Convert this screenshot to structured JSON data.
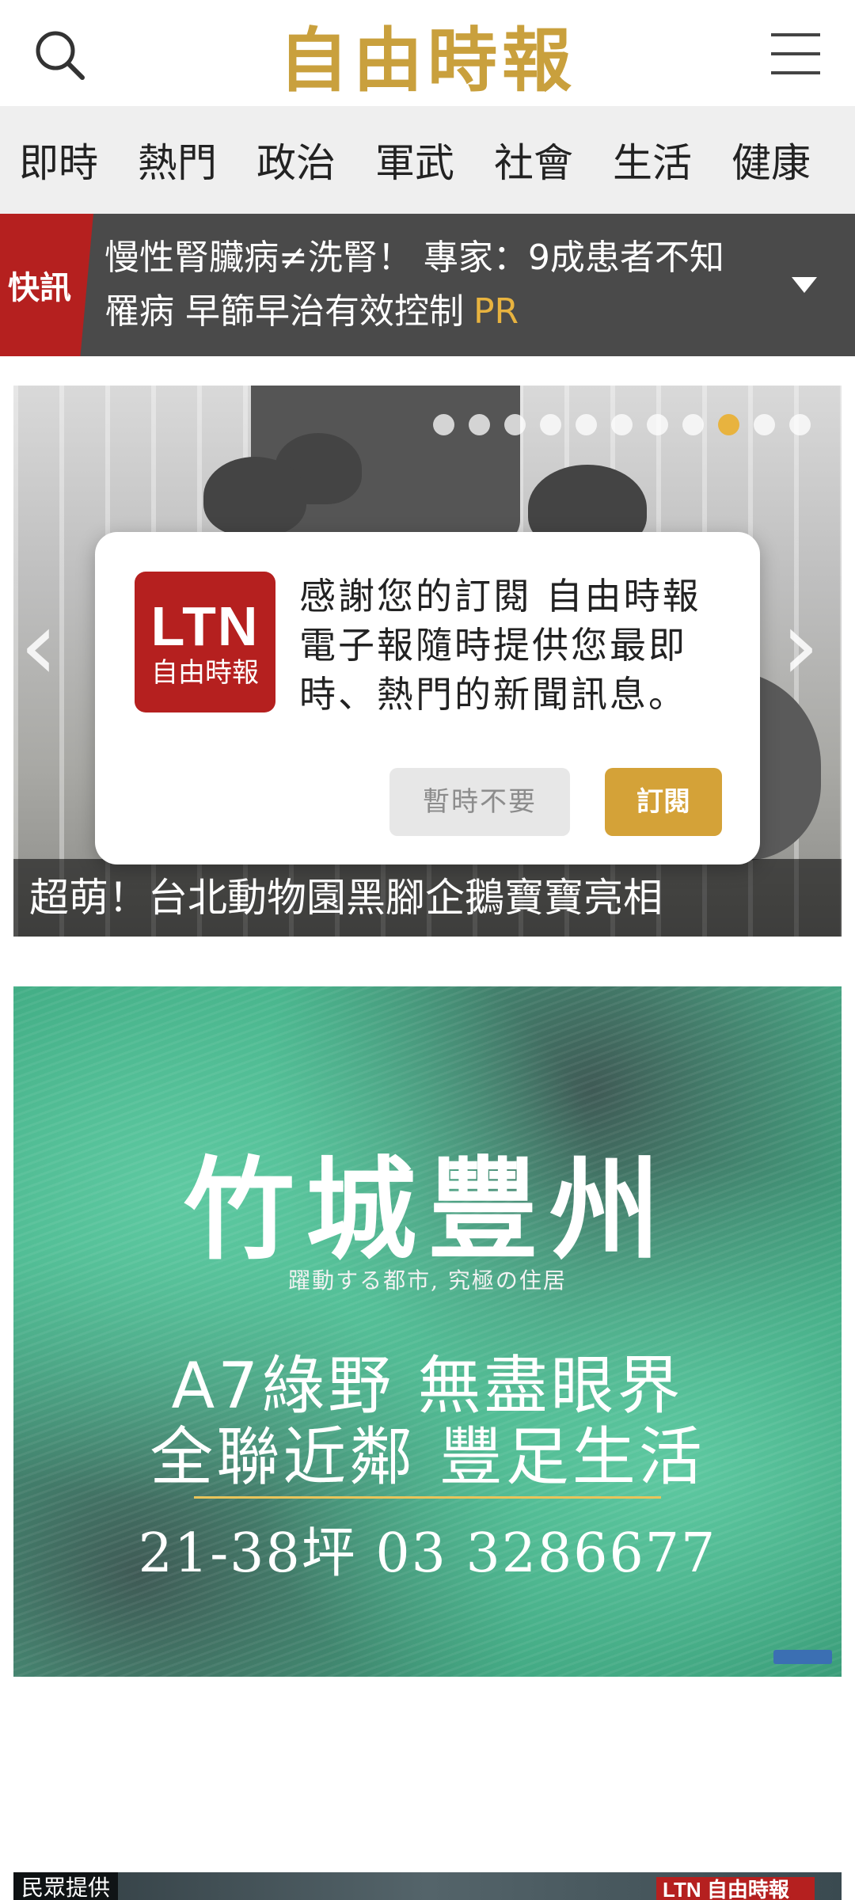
{
  "header": {
    "logo_text": "自由時報",
    "search_icon": "search-icon",
    "menu_icon": "hamburger-menu-icon"
  },
  "nav": {
    "items": [
      "即時",
      "熱門",
      "政治",
      "軍武",
      "社會",
      "生活",
      "健康"
    ]
  },
  "breaking": {
    "tag": "快訊",
    "headline": "慢性腎臟病≠洗腎！ 專家：9成患者不知罹病 早篩早治有效控制",
    "badge": "PR",
    "caret_icon": "chevron-down-icon"
  },
  "hero": {
    "caption": "超萌！台北動物園黑腳企鵝寶寶亮相",
    "dot_count": 11,
    "active_dot": 9,
    "prev_icon": "chevron-left-icon",
    "next_icon": "chevron-right-icon"
  },
  "dialog": {
    "logo_top": "LTN",
    "logo_bottom": "自由時報",
    "message": "感謝您的訂閱 自由時報電子報隨時提供您最即時、熱門的新聞訊息。",
    "later_label": "暫時不要",
    "subscribe_label": "訂閱"
  },
  "ad": {
    "brand": "竹城豐州",
    "tagline": "躍動する都市, 究極の住居",
    "line1": "A7綠野 無盡眼界",
    "line2": "全聯近鄰 豐足生活",
    "contact": "21-38坪 03 3286677"
  },
  "next_story": {
    "source": "民眾提供",
    "logo": "LTN 自由時報"
  },
  "colors": {
    "brand_gold": "#c9a03d",
    "brand_red": "#b5201f",
    "accent_button": "#d4a238",
    "active_dot": "#e8b33f"
  }
}
